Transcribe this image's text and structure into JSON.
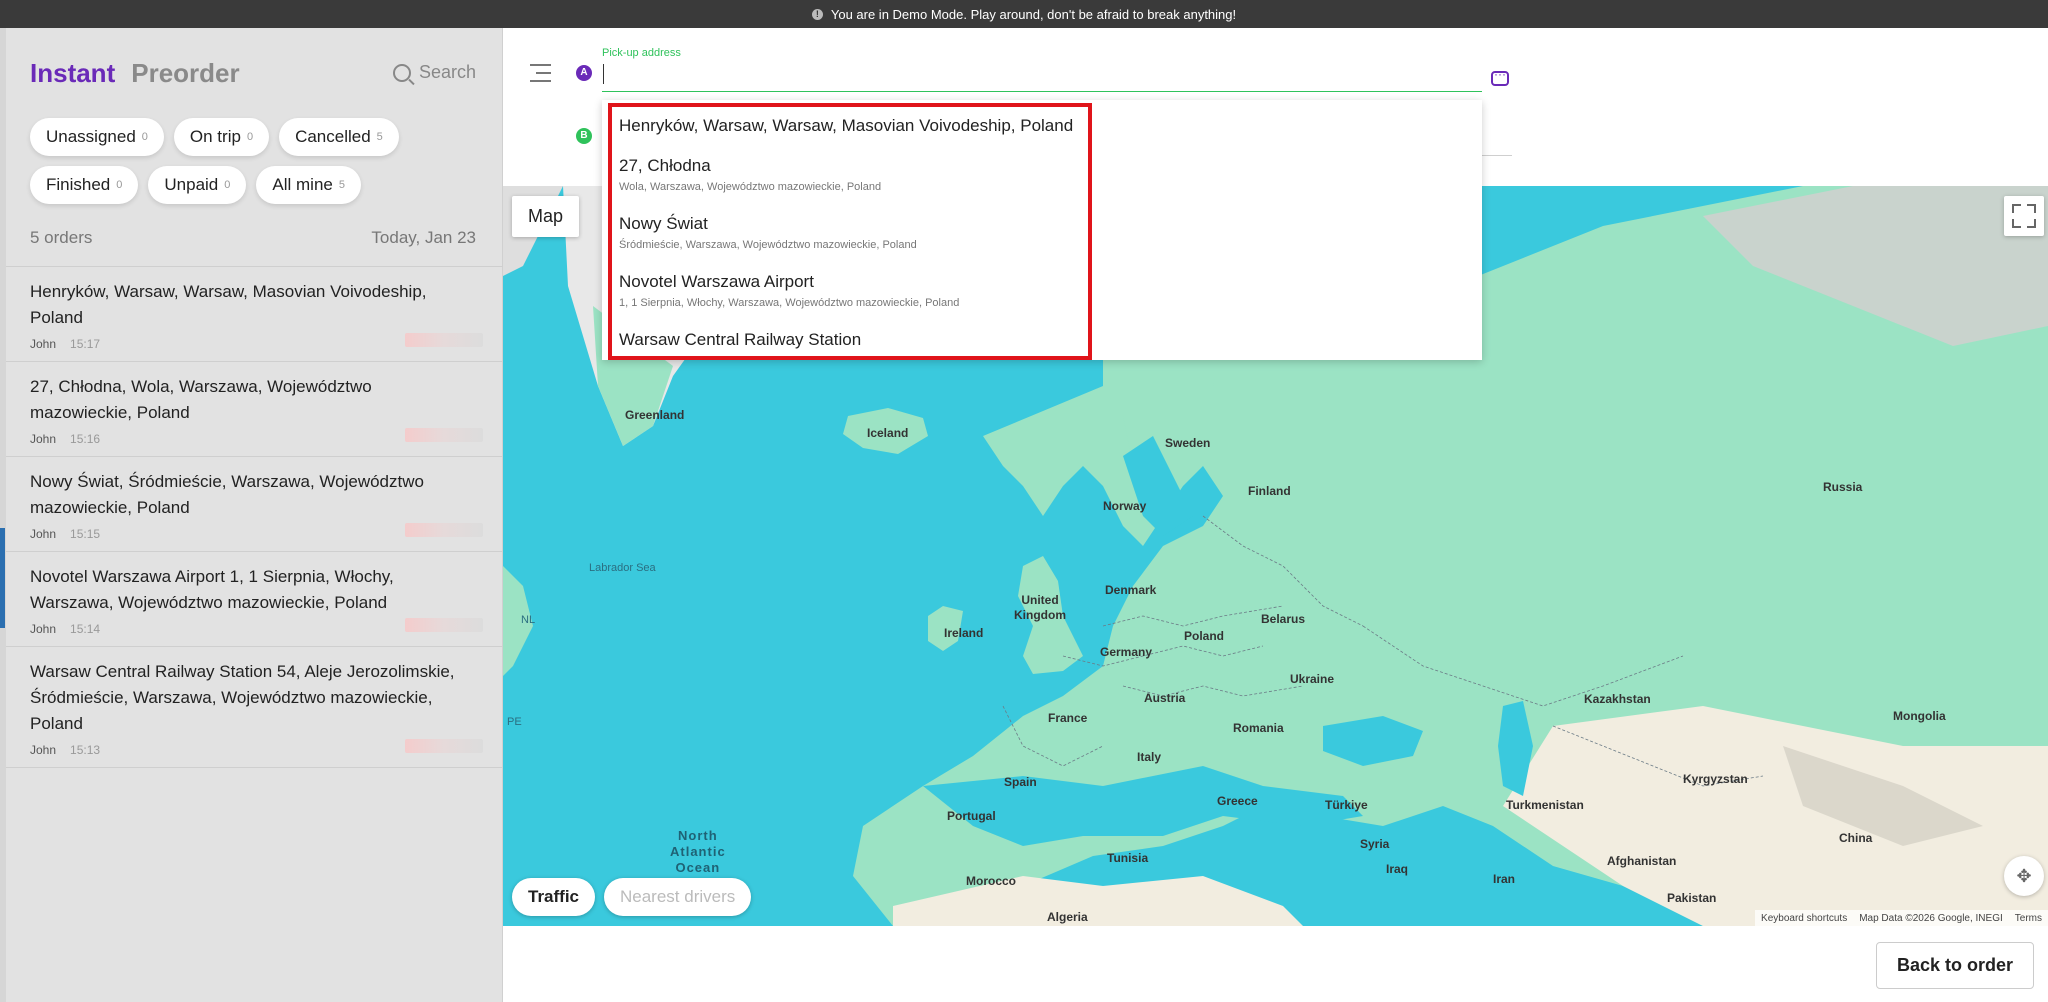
{
  "banner": {
    "text": "You are in Demo Mode. Play around, don't be afraid to break anything!"
  },
  "sidebar": {
    "tabs": [
      "Instant",
      "Preorder"
    ],
    "search_label": "Search",
    "filters": [
      {
        "label": "Unassigned",
        "count": "0"
      },
      {
        "label": "On trip",
        "count": "0"
      },
      {
        "label": "Cancelled",
        "count": "5"
      },
      {
        "label": "Finished",
        "count": "0"
      },
      {
        "label": "Unpaid",
        "count": "0"
      },
      {
        "label": "All mine",
        "count": "5"
      }
    ],
    "orders_count": "5 orders",
    "date": "Today, Jan 23",
    "orders": [
      {
        "address": "Henryków, Warsaw, Warsaw, Masovian Voivodeship, Poland",
        "user": "John",
        "time": "15:17"
      },
      {
        "address": "27, Chłodna, Wola, Warszawa, Województwo mazowieckie, Poland",
        "user": "John",
        "time": "15:16"
      },
      {
        "address": "Nowy Świat, Śródmieście, Warszawa, Województwo mazowieckie, Poland",
        "user": "John",
        "time": "15:15"
      },
      {
        "address": "Novotel Warszawa Airport 1, 1 Sierpnia, Włochy, Warszawa, Województwo mazowieckie, Poland",
        "user": "John",
        "time": "15:14"
      },
      {
        "address": "Warsaw Central Railway Station 54, Aleje Jerozolimskie, Śródmieście, Warszawa, Województwo mazowieckie, Poland",
        "user": "John",
        "time": "15:13"
      }
    ]
  },
  "form": {
    "pin_a": "A",
    "pin_b": "B",
    "pickup_label": "Pick-up address",
    "pickup_value": ""
  },
  "suggestions": [
    {
      "main": "Henryków, Warsaw, Warsaw, Masovian Voivodeship, Poland",
      "sub": ""
    },
    {
      "main": "27, Chłodna",
      "sub": "Wola, Warszawa, Województwo mazowieckie, Poland"
    },
    {
      "main": "Nowy Świat",
      "sub": "Śródmieście, Warszawa, Województwo mazowieckie, Poland"
    },
    {
      "main": "Novotel Warszawa Airport",
      "sub": "1, 1 Sierpnia, Włochy, Warszawa, Województwo mazowieckie, Poland"
    },
    {
      "main": "Warsaw Central Railway Station",
      "sub": ""
    }
  ],
  "map": {
    "type_button": "Map",
    "traffic_button": "Traffic",
    "nearest_drivers_button": "Nearest drivers",
    "labels": {
      "greenland": "Greenland",
      "iceland": "Iceland",
      "sweden": "Sweden",
      "norway": "Norway",
      "finland": "Finland",
      "russia": "Russia",
      "denmark": "Denmark",
      "united_kingdom": "United\nKingdom",
      "ireland": "Ireland",
      "belarus": "Belarus",
      "poland": "Poland",
      "germany": "Germany",
      "ukraine": "Ukraine",
      "kazakhstan": "Kazakhstan",
      "mongolia": "Mongolia",
      "france": "France",
      "austria": "Austria",
      "romania": "Romania",
      "italy": "Italy",
      "spain": "Spain",
      "portugal": "Portugal",
      "greece": "Greece",
      "turkiye": "Türkiye",
      "kyrgyzstan": "Kyrgyzstan",
      "turkmenistan": "Turkmenistan",
      "china": "China",
      "syria": "Syria",
      "iraq": "Iraq",
      "iran": "Iran",
      "afghanistan": "Afghanistan",
      "pakistan": "Pakistan",
      "tunisia": "Tunisia",
      "morocco": "Morocco",
      "algeria": "Algeria",
      "labrador_sea": "Labrador Sea",
      "north_atlantic": "North\nAtlantic\nOcean",
      "nl": "NL",
      "pe": "PE"
    },
    "attribution": {
      "shortcuts": "Keyboard shortcuts",
      "data": "Map Data ©2026 Google, INEGI",
      "terms": "Terms"
    }
  },
  "footer": {
    "back_button": "Back to order"
  },
  "colors": {
    "accent": "#6a2ab8",
    "green": "#2fc25b",
    "highlight": "#e0141a",
    "water": "#3ac9dd",
    "land": "#9be3c4"
  }
}
